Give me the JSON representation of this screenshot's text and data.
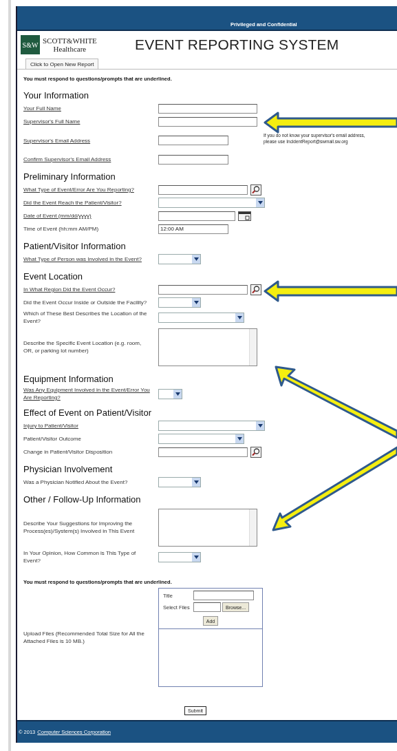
{
  "header": {
    "banner": "Privileged and Confidential"
  },
  "logo": {
    "mark": "S&W",
    "name": "SCOTT&WHITE",
    "sub": "Healthcare"
  },
  "title": "EVENT REPORTING SYSTEM",
  "tabs": [
    {
      "label": "Click to Open New Report",
      "selected": true
    }
  ],
  "notice": "You must respond to questions/prompts that are underlined.",
  "sections": [
    {
      "heading": "Your Information",
      "fields": [
        {
          "label": "Your Full Name",
          "required": true,
          "kind": "text"
        },
        {
          "label": "Supervisor's Full Name",
          "required": true,
          "kind": "text"
        },
        {
          "label": "Supervisor's Email Address",
          "required": true,
          "kind": "shorttext",
          "note": "If you do not know your supervisor's email address, please use IncidentReport@swmail.sw.org"
        },
        {
          "label": "Confirm Supervisor's Email Address",
          "required": true,
          "kind": "shorttext"
        }
      ]
    },
    {
      "heading": "Preliminary Information",
      "fields": [
        {
          "label": "What Type of Event/Error Are You Reporting?",
          "required": true,
          "kind": "lookup"
        },
        {
          "label": "Did the Event Reach the Patient/Visitor?",
          "required": true,
          "kind": "select"
        },
        {
          "label": "Date of Event (mm/dd/yyyy)",
          "required": true,
          "kind": "date"
        },
        {
          "label": "Time of Event (hh:mm AM/PM)",
          "required": false,
          "kind": "shorttext",
          "value": "12:00 AM"
        }
      ]
    },
    {
      "heading": "Patient/Visitor Information",
      "fields": [
        {
          "label": "What Type of Person was Involved in the Event?",
          "required": true,
          "kind": "shortselect"
        }
      ]
    },
    {
      "heading": "Event Location",
      "fields": [
        {
          "label": "In What Region Did the Event Occur?",
          "required": true,
          "kind": "lookup"
        },
        {
          "label": "Did the Event Occur Inside or Outside the Facility?",
          "required": false,
          "kind": "shortselect"
        },
        {
          "label": "Which of These Best Describes the Location of the Event?",
          "required": false,
          "kind": "mediumselect"
        },
        {
          "label": "Describe the Specific Event Location (e.g. room, OR, or parking lot number)",
          "required": false,
          "kind": "textarea"
        }
      ]
    },
    {
      "heading": "Equipment Information",
      "fields": [
        {
          "label": "Was Any Equipment Involved in the Event/Error You Are Reporting?",
          "required": true,
          "kind": "tinyselect"
        }
      ]
    },
    {
      "heading": "Effect of Event on Patient/Visitor",
      "fields": [
        {
          "label": "Injury to Patient/Visitor",
          "required": true,
          "kind": "select"
        },
        {
          "label": "Patient/Visitor Outcome",
          "required": false,
          "kind": "mediumselect"
        },
        {
          "label": "Change in Patient/Visitor Disposition",
          "required": false,
          "kind": "lookup"
        }
      ]
    },
    {
      "heading": "Physician Involvement",
      "fields": [
        {
          "label": "Was a Physician Notified About the Event?",
          "required": false,
          "kind": "shortselect"
        }
      ]
    },
    {
      "heading": "Other / Follow-Up Information",
      "fields": [
        {
          "label": "Describe Your Suggestions for Improving the Process(es)/System(s) Involved in This Event",
          "required": false,
          "kind": "textarea"
        },
        {
          "label": "In Your Opinion, How Common is This Type of Event?",
          "required": false,
          "kind": "shortselect"
        }
      ]
    }
  ],
  "notice_bottom": "You must respond to questions/prompts that are underlined.",
  "upload": {
    "label": "Upload Files (Recommended Total Size for All the Attached Files is 10 MB.)",
    "title_label": "Title",
    "files_label": "Select Files",
    "browse": "Browse...",
    "add": "Add"
  },
  "submit": "Submit",
  "footer": {
    "copyright": "© 2013",
    "link": "Computer Sciences Corporation"
  }
}
